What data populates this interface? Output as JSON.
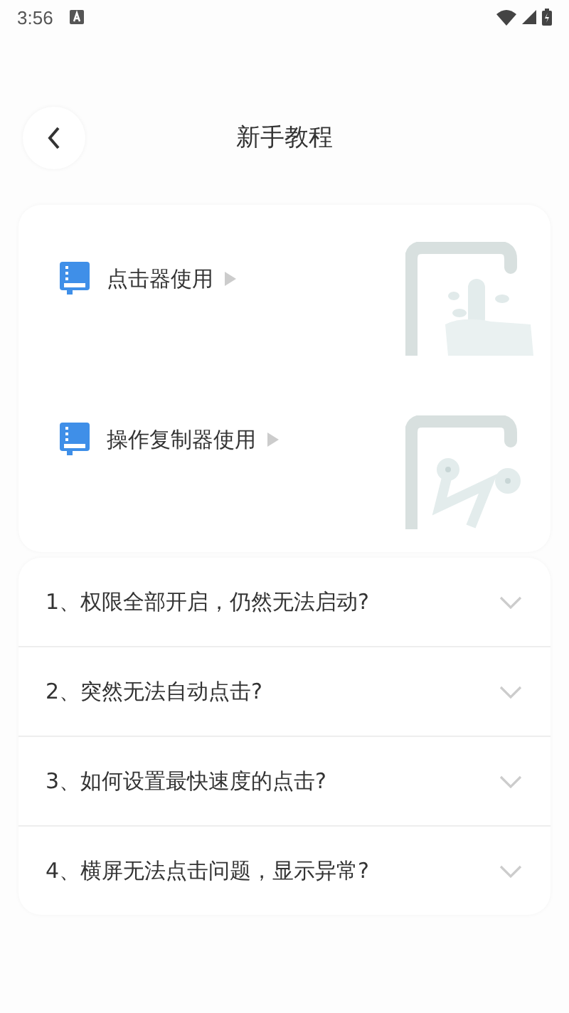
{
  "status_bar": {
    "time": "3:56"
  },
  "header": {
    "title": "新手教程"
  },
  "tutorials": [
    {
      "label": "点击器使用",
      "kind": "tap"
    },
    {
      "label": "操作复制器使用",
      "kind": "path"
    }
  ],
  "faq": [
    {
      "question": "1、权限全部开启，仍然无法启动?",
      "expanded": false
    },
    {
      "question": "2、突然无法自动点击?",
      "expanded": false
    },
    {
      "question": "3、如何设置最快速度的点击?",
      "expanded": false
    },
    {
      "question": "4、横屏无法点击问题，显示异常?",
      "expanded": false
    }
  ]
}
